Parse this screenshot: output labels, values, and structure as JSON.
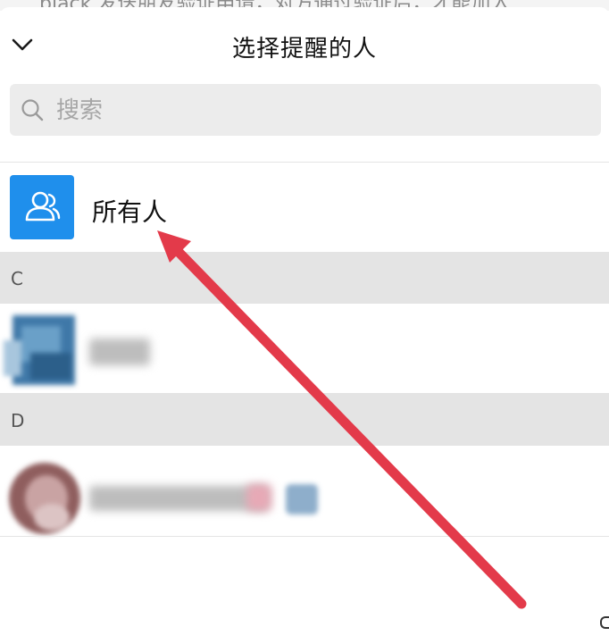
{
  "background": {
    "partial_text": "black 发送朋友验证申请，对方通过验证后，才能加入"
  },
  "header": {
    "title": "选择提醒的人",
    "collapse_icon": "chevron-down-icon"
  },
  "search": {
    "placeholder": "搜索",
    "value": "",
    "icon": "search-icon"
  },
  "everyone": {
    "label": "所有人",
    "icon": "group-people-icon",
    "avatar_color": "#1f8fec"
  },
  "sections": [
    {
      "letter": "C",
      "contacts": [
        {
          "name": "",
          "avatar": "blurred-avatar"
        }
      ]
    },
    {
      "letter": "D",
      "contacts": [
        {
          "name": "",
          "avatar": "blurred-avatar",
          "badge": "blurred-badge"
        }
      ]
    }
  ],
  "annotation": {
    "type": "red-arrow",
    "color": "#e33a4a",
    "target": "everyone"
  }
}
